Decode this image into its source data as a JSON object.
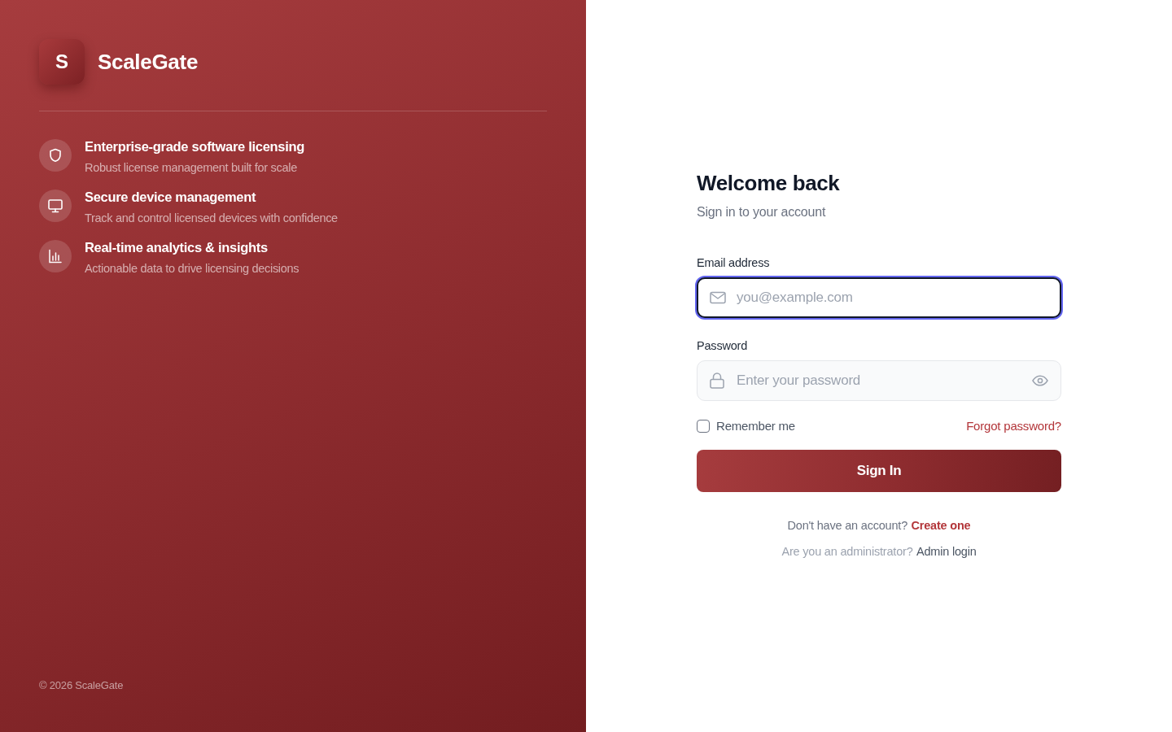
{
  "brand": {
    "logo_letter": "S",
    "name": "ScaleGate"
  },
  "features": [
    {
      "kind": "shield",
      "title": "Enterprise-grade software licensing",
      "description": "Robust license management built for scale"
    },
    {
      "kind": "monitor",
      "title": "Secure device management",
      "description": "Track and control licensed devices with confidence"
    },
    {
      "kind": "chart",
      "title": "Real-time analytics & insights",
      "description": "Actionable data to drive licensing decisions"
    }
  ],
  "copyright": "© 2026 ScaleGate",
  "login": {
    "title": "Welcome back",
    "subtitle": "Sign in to your account",
    "fields": [
      {
        "kind": "email",
        "label": "Email address",
        "placeholder": "you@example.com",
        "focused": true
      },
      {
        "kind": "password",
        "label": "Password",
        "placeholder": "Enter your password",
        "focused": false
      }
    ],
    "remember": {
      "label": "Remember me",
      "checked": false
    },
    "forgot_link": "Forgot password?",
    "submit": "Sign In",
    "signup": {
      "prompt": "Don't have an account?",
      "link": "Create one"
    },
    "admin": {
      "prompt": "Are you an administrator?",
      "link": "Admin login"
    }
  }
}
